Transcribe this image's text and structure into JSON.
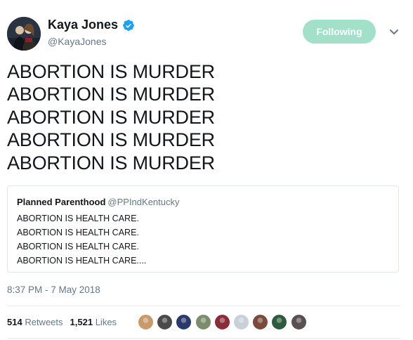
{
  "author": {
    "display_name": "Kaya Jones",
    "handle": "@KayaJones",
    "verified_icon": "verified-badge-icon",
    "avatar_icon": "profile-photo"
  },
  "follow_button": {
    "label": "Following",
    "color": "#a2e0c9"
  },
  "more_menu_icon": "chevron-down-icon",
  "tweet": {
    "lines": [
      "ABORTION IS MURDER",
      "ABORTION IS MURDER",
      "ABORTION IS MURDER",
      "ABORTION IS MURDER",
      "ABORTION IS MURDER"
    ]
  },
  "quoted_tweet": {
    "author_name": "Planned Parenthood",
    "author_handle": "@PPIndKentucky",
    "lines": [
      "ABORTION IS HEALTH CARE.",
      "ABORTION IS HEALTH CARE.",
      "ABORTION IS HEALTH CARE.",
      "ABORTION IS HEALTH CARE...."
    ]
  },
  "timestamp": "8:37 PM - 7 May 2018",
  "stats": {
    "retweets_count": "514",
    "retweets_label": "Retweets",
    "likes_count": "1,521",
    "likes_label": "Likes"
  },
  "likers": [
    {
      "icon": "liker-avatar-1",
      "color": "#c79b6b"
    },
    {
      "icon": "liker-avatar-2",
      "color": "#4a4a4a"
    },
    {
      "icon": "liker-avatar-3",
      "color": "#2b3a6b"
    },
    {
      "icon": "liker-avatar-4",
      "color": "#7d8c6a"
    },
    {
      "icon": "liker-avatar-5",
      "color": "#8a2d3a"
    },
    {
      "icon": "liker-avatar-6",
      "color": "#c8d0d8"
    },
    {
      "icon": "liker-avatar-7",
      "color": "#7a4a3a"
    },
    {
      "icon": "liker-avatar-8",
      "color": "#2e5a3e"
    },
    {
      "icon": "liker-avatar-9",
      "color": "#5a5050"
    }
  ],
  "colors": {
    "text": "#14171a",
    "secondary": "#657786",
    "verified": "#1da1f2",
    "border": "#e1e8ed"
  }
}
